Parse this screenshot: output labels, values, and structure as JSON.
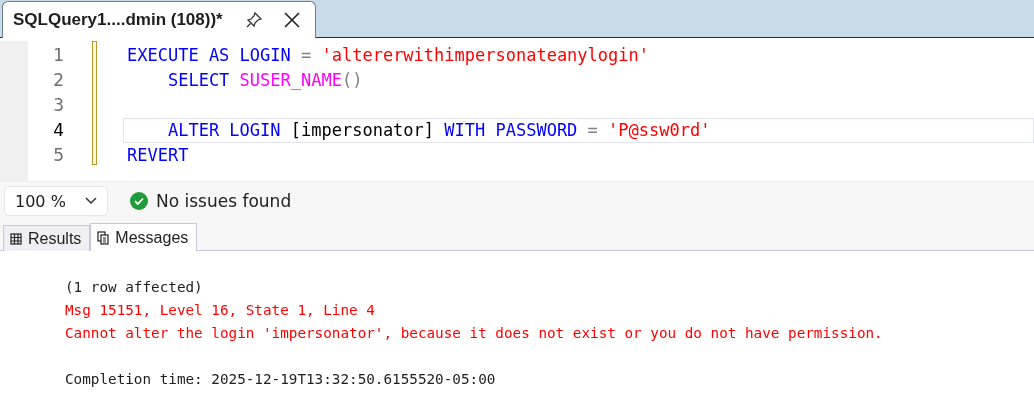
{
  "document_tab": {
    "title": "SQLQuery1....dmin (108))*"
  },
  "editor": {
    "lines": [
      {
        "number": "1",
        "current": false,
        "tokens": [
          {
            "kind": "keyword",
            "text": "EXECUTE AS LOGIN"
          },
          {
            "kind": "operator",
            "text": " = "
          },
          {
            "kind": "string",
            "text": "'altererwithimpersonateanylogin'"
          }
        ]
      },
      {
        "number": "2",
        "current": false,
        "tokens": [
          {
            "kind": "keyword",
            "text": "    SELECT "
          },
          {
            "kind": "function",
            "text": "SUSER_NAME"
          },
          {
            "kind": "operator",
            "text": "()"
          }
        ]
      },
      {
        "number": "3",
        "current": false
      },
      {
        "number": "4",
        "current": true,
        "tokens": [
          {
            "kind": "keyword",
            "text": "    ALTER LOGIN "
          },
          {
            "kind": "plain",
            "text": "[impersonator] "
          },
          {
            "kind": "keyword",
            "text": "WITH PASSWORD "
          },
          {
            "kind": "operator",
            "text": "= "
          },
          {
            "kind": "string",
            "text": "'P@ssw0rd'"
          }
        ]
      },
      {
        "number": "5",
        "current": false,
        "tokens": [
          {
            "kind": "keyword",
            "text": "REVERT"
          }
        ]
      }
    ]
  },
  "status": {
    "zoom": "100 %",
    "issues": "No issues found"
  },
  "result_tabs": [
    {
      "label": "Results",
      "selected": false,
      "kind": "grid"
    },
    {
      "label": "Messages",
      "selected": true,
      "kind": "messages"
    }
  ],
  "messages": [
    {
      "kind": "info",
      "text": "(1 row affected)"
    },
    {
      "kind": "error",
      "text": "Msg 15151, Level 16, State 1, Line 4"
    },
    {
      "kind": "error",
      "text": "Cannot alter the login 'impersonator', because it does not exist or you do not have permission."
    },
    {
      "kind": "blank"
    },
    {
      "kind": "info",
      "text": "Completion time: 2025-12-19T13:32:50.6155520-05:00"
    }
  ]
}
